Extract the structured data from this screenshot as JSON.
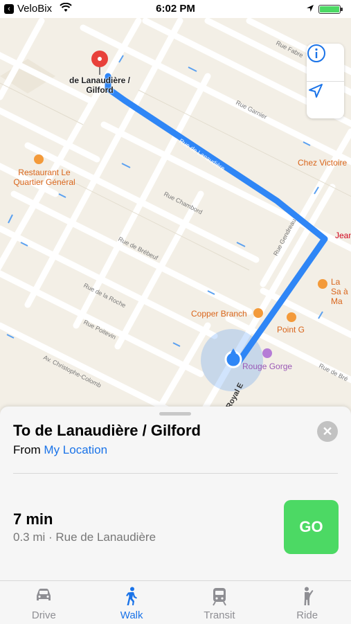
{
  "status_bar": {
    "back_glyph": "‹",
    "carrier": "VeloBix",
    "time": "6:02 PM"
  },
  "map": {
    "destination_label": "de Lanaudière / Gilford",
    "pois": {
      "restaurant_le_quartier": "Restaurant Le Quartier Général",
      "chez_victoire": "Chez Victoire",
      "copper_branch": "Copper Branch",
      "point_g": "Point G",
      "rouge_gorge": "Rouge Gorge",
      "jean": "Jean",
      "la_sa": "La Sa à Ma"
    },
    "streets": {
      "rue_fabre": "Rue Fabre",
      "rue_garnier": "Rue Garnier",
      "rue_de_lanaudiere": "Rue de Lanaudière",
      "rue_chambord": "Rue Chambord",
      "rue_de_brebeuf": "Rue de Brébeuf",
      "rue_de_la_roche": "Rue de la Roche",
      "rue_poitevin": "Rue Poitevin",
      "av_christophe_colomb": "Av. Christophe-Colomb",
      "rue_gendreau": "Rue Gendreau",
      "royal_e": "Royal E",
      "rue_bre_right": "Rue de Bré"
    },
    "route_color": "#2f86f6"
  },
  "sheet": {
    "title": "To de Lanaudière / Gilford",
    "from_prefix": "From",
    "from_location": "My Location",
    "close_glyph": "✕",
    "duration": "7 min",
    "detail": "0.3 mi · Rue de Lanaudière",
    "go_label": "GO"
  },
  "tabs": [
    {
      "label": "Drive",
      "icon": "car-icon",
      "active": false
    },
    {
      "label": "Walk",
      "icon": "walk-icon",
      "active": true
    },
    {
      "label": "Transit",
      "icon": "transit-icon",
      "active": false
    },
    {
      "label": "Ride",
      "icon": "ride-icon",
      "active": false
    }
  ]
}
